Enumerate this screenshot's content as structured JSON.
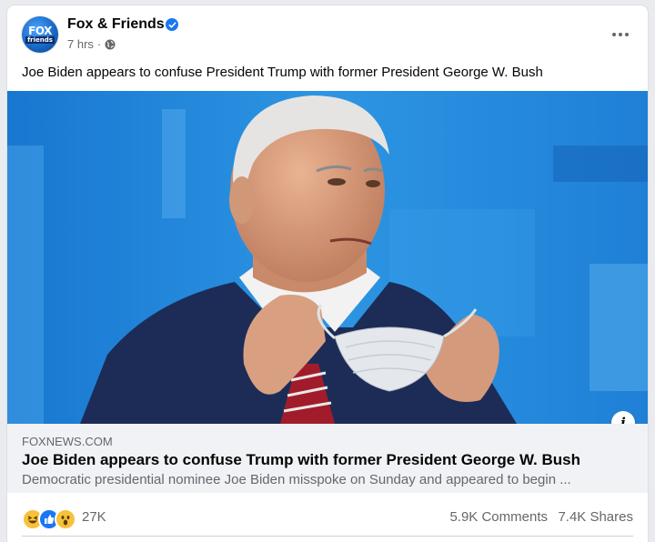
{
  "post": {
    "page_name": "Fox & Friends",
    "verified": true,
    "time": "7 hrs",
    "separator": "·",
    "privacy_icon": "globe-icon",
    "more_icon": "more-options-icon",
    "text": "Joe Biden appears to confuse President Trump with former President George W. Bush",
    "avatar": {
      "line1": "FOX",
      "line2": "friends"
    }
  },
  "link": {
    "domain": "FOXNEWS.COM",
    "title": "Joe Biden appears to confuse Trump with former President George W. Bush",
    "description": "Democratic presidential nominee Joe Biden misspoke on Sunday and appeared to begin ...",
    "info_icon": "i"
  },
  "stats": {
    "reaction_count": "27K",
    "comments": "5.9K Comments",
    "shares": "7.4K Shares",
    "reactions": [
      "haha-icon",
      "like-icon",
      "wow-icon"
    ]
  },
  "colors": {
    "brand_blue": "#1877f2",
    "text_primary": "#050505",
    "text_secondary": "#65676b",
    "link_bg": "#f0f2f5"
  }
}
